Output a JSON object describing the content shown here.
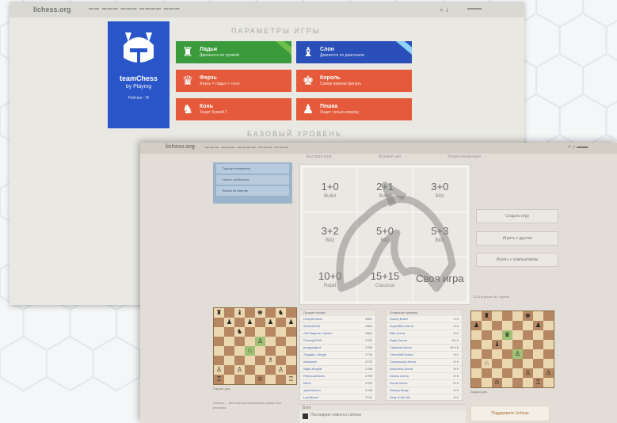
{
  "back_screen": {
    "logo": "lichess.org",
    "section_title": "ПАРАМЕТРЫ ИГРЫ",
    "section_title2": "БАЗОВЫЙ УРОВЕНЬ",
    "team_card": {
      "name": "teamChess",
      "subtitle": "by Playing",
      "rank": "Рейтинг: 76"
    },
    "tiles": [
      {
        "title": "Ладьи",
        "subtitle": "Двигаются по прямой",
        "color": "#3a9a3c",
        "icon": "rook-icon",
        "glyph": "♜",
        "ribbon": true
      },
      {
        "title": "Слон",
        "subtitle": "Двигается по диагонали",
        "color": "#2a4fb8",
        "icon": "bishop-icon",
        "glyph": "♝",
        "ribbon": true
      },
      {
        "title": "Ферзь",
        "subtitle": "Ферзь = ладья + слон",
        "color": "#e45a3a",
        "icon": "queen-icon",
        "glyph": "♛",
        "ribbon": false
      },
      {
        "title": "Король",
        "subtitle": "Самая важная фигура",
        "color": "#e45a3a",
        "icon": "king-icon",
        "glyph": "♚",
        "ribbon": false
      },
      {
        "title": "Конь",
        "subtitle": "Ходит буквой Г",
        "color": "#e45a3a",
        "icon": "knight-icon",
        "glyph": "♞",
        "ribbon": false
      },
      {
        "title": "Пешка",
        "subtitle": "Ходит только вперёд",
        "color": "#e45a3a",
        "icon": "pawn-icon",
        "glyph": "♟",
        "ribbon": false
      }
    ]
  },
  "front_screen": {
    "logo": "lichess.org",
    "tabs": [
      "Быстрая игра",
      "Игровой зал",
      "Корреспонденция"
    ],
    "notifications": [
      "Турнир начинается",
      "Новое сообщение",
      "Вызов на партию"
    ],
    "quick_pairing": [
      {
        "clock": "1+0",
        "type": "Bullet"
      },
      {
        "clock": "2+1",
        "type": "Bullet"
      },
      {
        "clock": "3+0",
        "type": "Blitz"
      },
      {
        "clock": "3+2",
        "type": "Blitz"
      },
      {
        "clock": "5+0",
        "type": "Blitz"
      },
      {
        "clock": "5+3",
        "type": "Blitz"
      },
      {
        "clock": "10+0",
        "type": "Rapid"
      },
      {
        "clock": "15+15",
        "type": "Classical"
      },
      {
        "clock": "Своя игра",
        "type": ""
      }
    ],
    "side_buttons": [
      "Создать игру",
      "Играть с другом",
      "Играть с компьютером"
    ],
    "leaderboard_title": "Лучшие игроки",
    "leaderboard": [
      {
        "name": "DrNykterstein",
        "score": "2851"
      },
      {
        "name": "Alireza2003",
        "score": "2810"
      },
      {
        "name": "GM Magnus Carlsen",
        "score": "2804"
      },
      {
        "name": "Firouzja2003",
        "score": "2792"
      },
      {
        "name": "penguingim1",
        "score": "2785"
      },
      {
        "name": "Zhigalko_Sergei",
        "score": "2776"
      },
      {
        "name": "nihalsarin",
        "score": "2770"
      },
      {
        "name": "Night-King96",
        "score": "2766"
      },
      {
        "name": "RebeccaHarris",
        "score": "2759"
      },
      {
        "name": "Msb2",
        "score": "2752"
      },
      {
        "name": "opperwezen",
        "score": "2748"
      },
      {
        "name": "LyonBeast",
        "score": "2741"
      }
    ],
    "tournaments_title": "Открытые турниры",
    "tournaments": [
      {
        "name": "Hourly Bullet",
        "info": "1+0"
      },
      {
        "name": "SuperBlitz Arena",
        "info": "3+0"
      },
      {
        "name": "Blitz Arena",
        "info": "5+0"
      },
      {
        "name": "Rapid Arena",
        "info": "10+0"
      },
      {
        "name": "Classical Arena",
        "info": "15+15"
      },
      {
        "name": "Chess960 Arena",
        "info": "3+2"
      },
      {
        "name": "Crazyhouse Arena",
        "info": "3+0"
      },
      {
        "name": "Antichess Arena",
        "info": "3+0"
      },
      {
        "name": "Atomic Arena",
        "info": "3+0"
      },
      {
        "name": "Horde Arena",
        "info": "5+0"
      },
      {
        "name": "Racing Kings",
        "info": "3+0"
      },
      {
        "name": "King of the Hill",
        "info": "3+0"
      }
    ],
    "online_info": "1234 игроков\n567 партий",
    "board_caption_left": "Партия дня",
    "board_caption_right": "Задача дня",
    "blog_head": "Блог",
    "blog_entry": "Последние новости Lichess",
    "promo": "Поддержите Lichess",
    "footer": "Lichess — бесплатный шахматный сервер без рекламы"
  }
}
